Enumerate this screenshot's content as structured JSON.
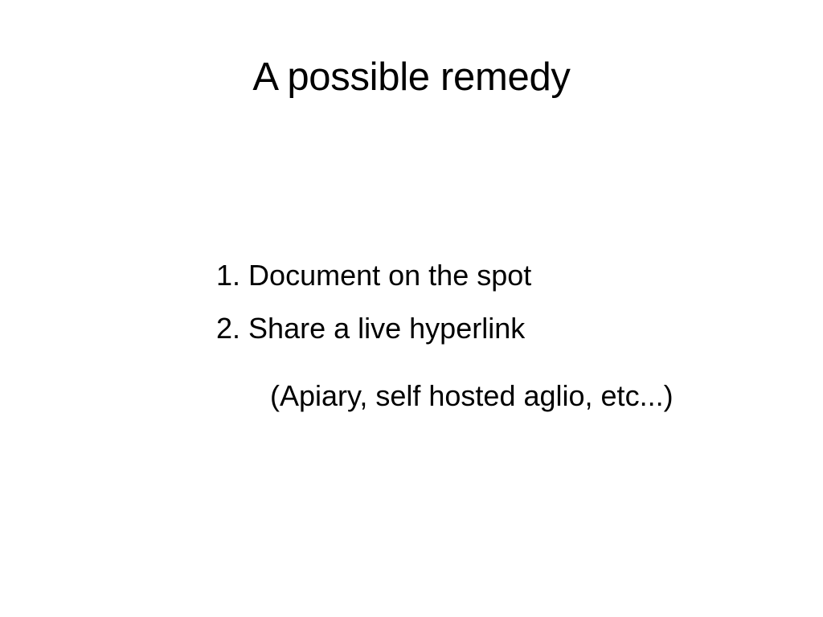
{
  "slide": {
    "title": "A possible remedy",
    "items": [
      {
        "number": "1.",
        "text": "Document on the spot"
      },
      {
        "number": "2.",
        "text": "Share a live hyperlink"
      }
    ],
    "note": "(Apiary, self hosted aglio, etc...)"
  }
}
